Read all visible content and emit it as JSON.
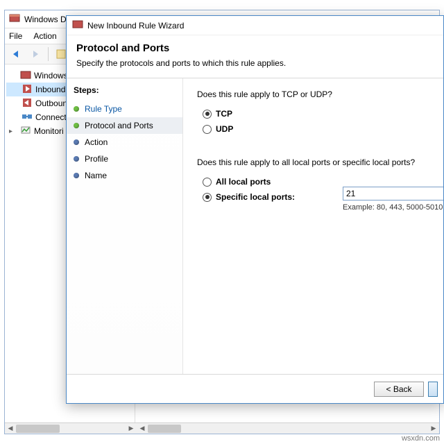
{
  "main_window": {
    "title": "Windows Defender Firewall with Advanced Security",
    "menu": {
      "file": "File",
      "action": "Action"
    },
    "tree": {
      "root": "Windows De",
      "inbound": "Inbound",
      "outbound": "Outboun",
      "connect": "Connect",
      "monitor": "Monitori"
    }
  },
  "wizard": {
    "window_title": "New Inbound Rule Wizard",
    "heading": "Protocol and Ports",
    "subheading": "Specify the protocols and ports to which this rule applies.",
    "steps_label": "Steps:",
    "steps": {
      "rule_type": "Rule Type",
      "protocol_ports": "Protocol and Ports",
      "action": "Action",
      "profile": "Profile",
      "name": "Name"
    },
    "q1": "Does this rule apply to TCP or UDP?",
    "tcp": "TCP",
    "udp": "UDP",
    "q2": "Does this rule apply to all local ports or specific local ports?",
    "all_ports": "All local ports",
    "specific_ports": "Specific local ports:",
    "port_value": "21",
    "example": "Example: 80, 443, 5000-5010",
    "back": "< Back"
  },
  "watermark": "wsxdn.com"
}
